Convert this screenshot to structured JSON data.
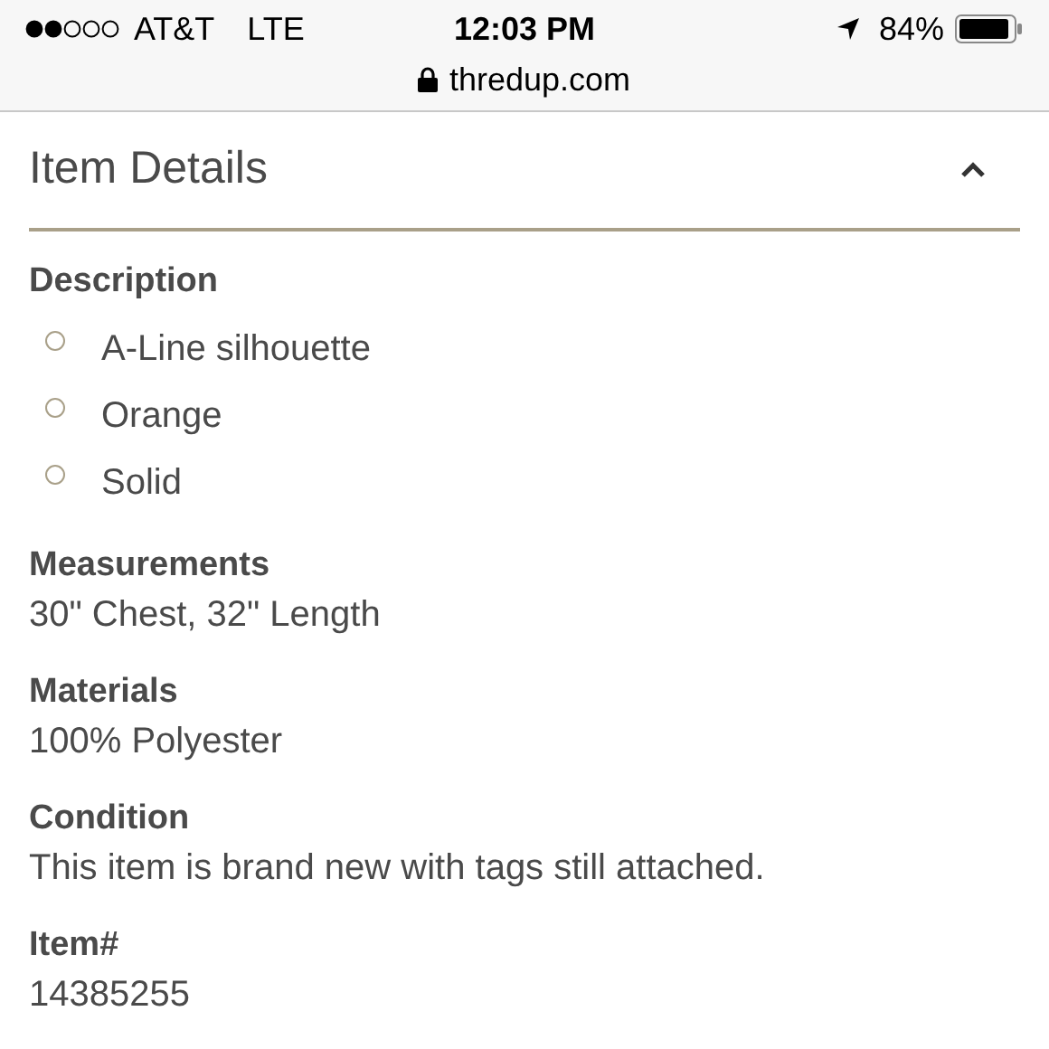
{
  "status_bar": {
    "carrier": "AT&T",
    "network": "LTE",
    "time": "12:03 PM",
    "battery": "84%"
  },
  "address_bar": {
    "url": "thredup.com"
  },
  "panel": {
    "title": "Item Details",
    "expanded": true,
    "sections": [
      {
        "kind": "list",
        "label": "Description",
        "items": [
          "A-Line silhouette",
          "Orange",
          "Solid"
        ]
      },
      {
        "kind": "text",
        "label": "Measurements",
        "value": "30\" Chest, 32\" Length"
      },
      {
        "kind": "text",
        "label": "Materials",
        "value": "100% Polyester"
      },
      {
        "kind": "text",
        "label": "Condition",
        "value": "This item is brand new with tags still attached."
      },
      {
        "kind": "text",
        "label": "Item#",
        "value": "14385255"
      }
    ]
  }
}
